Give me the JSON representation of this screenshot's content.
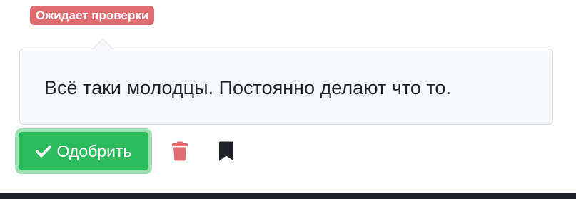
{
  "status": {
    "label": "Ожидает проверки",
    "color": "#e06c70"
  },
  "comment": {
    "text": "Всё таки молодцы. Постоянно делают что то."
  },
  "actions": {
    "approve_label": "Одобрить",
    "approve_icon": "check-icon",
    "delete_icon": "trash-icon",
    "bookmark_icon": "bookmark-icon"
  },
  "colors": {
    "approve": "#2dbb5d",
    "delete": "#e06c70",
    "bookmark": "#212529"
  }
}
